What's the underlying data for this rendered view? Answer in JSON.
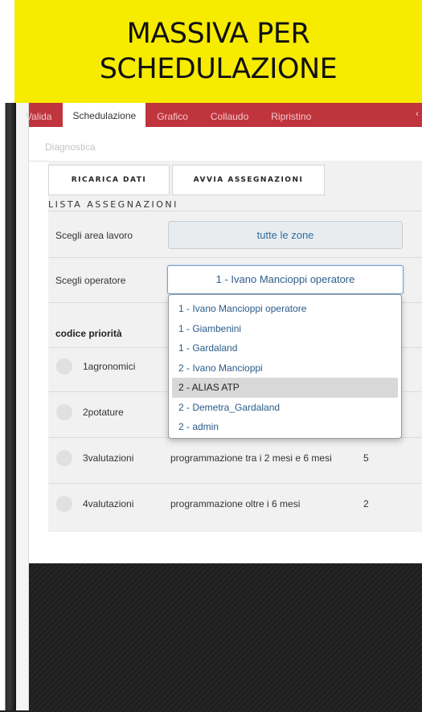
{
  "banner": {
    "line1": "MASSIVA PER",
    "line2": "SCHEDULAZIONE"
  },
  "tabs": [
    {
      "label": "Valida",
      "active": false
    },
    {
      "label": "Schedulazione",
      "active": true
    },
    {
      "label": "Grafico",
      "active": false
    },
    {
      "label": "Collaudo",
      "active": false
    },
    {
      "label": "Ripristino",
      "active": false
    }
  ],
  "subnav": {
    "label": "Diagnostica"
  },
  "toolbar": {
    "reload_label": "RICARICA DATI",
    "assign_label": "AVVIA ASSEGNAZIONI"
  },
  "list": {
    "title": "LISTA ASSEGNAZIONI"
  },
  "filters": {
    "area_label": "Scegli area lavoro",
    "area_value": "tutte le zone",
    "operator_label": "Scegli operatore",
    "operator_value": "1 - Ivano Mancioppi operatore"
  },
  "dropdown": {
    "options": [
      "1 - Ivano Mancioppi operatore",
      "1 - Giambenini",
      "1 - Gardaland",
      "2 - Ivano Mancioppi",
      "2 - ALIAS ATP",
      "2 - Demetra_Gardaland",
      "2 - admin"
    ],
    "highlighted": "2 - ALIAS ATP"
  },
  "table": {
    "header": "codice priorità",
    "rows": [
      {
        "code": "1agronomici",
        "description": "",
        "count": ""
      },
      {
        "code": "2potature",
        "description": "",
        "count": ""
      },
      {
        "code": "3valutazioni",
        "description": "programmazione tra i 2 mesi e 6 mesi",
        "count": "5"
      },
      {
        "code": "4valutazioni",
        "description": "programmazione oltre i 6 mesi",
        "count": "2"
      }
    ]
  },
  "colors": {
    "banner": "#f7ec00",
    "tabbar": "#c0343d",
    "link": "#2e6e9e",
    "footer": "#1f1f1f"
  }
}
